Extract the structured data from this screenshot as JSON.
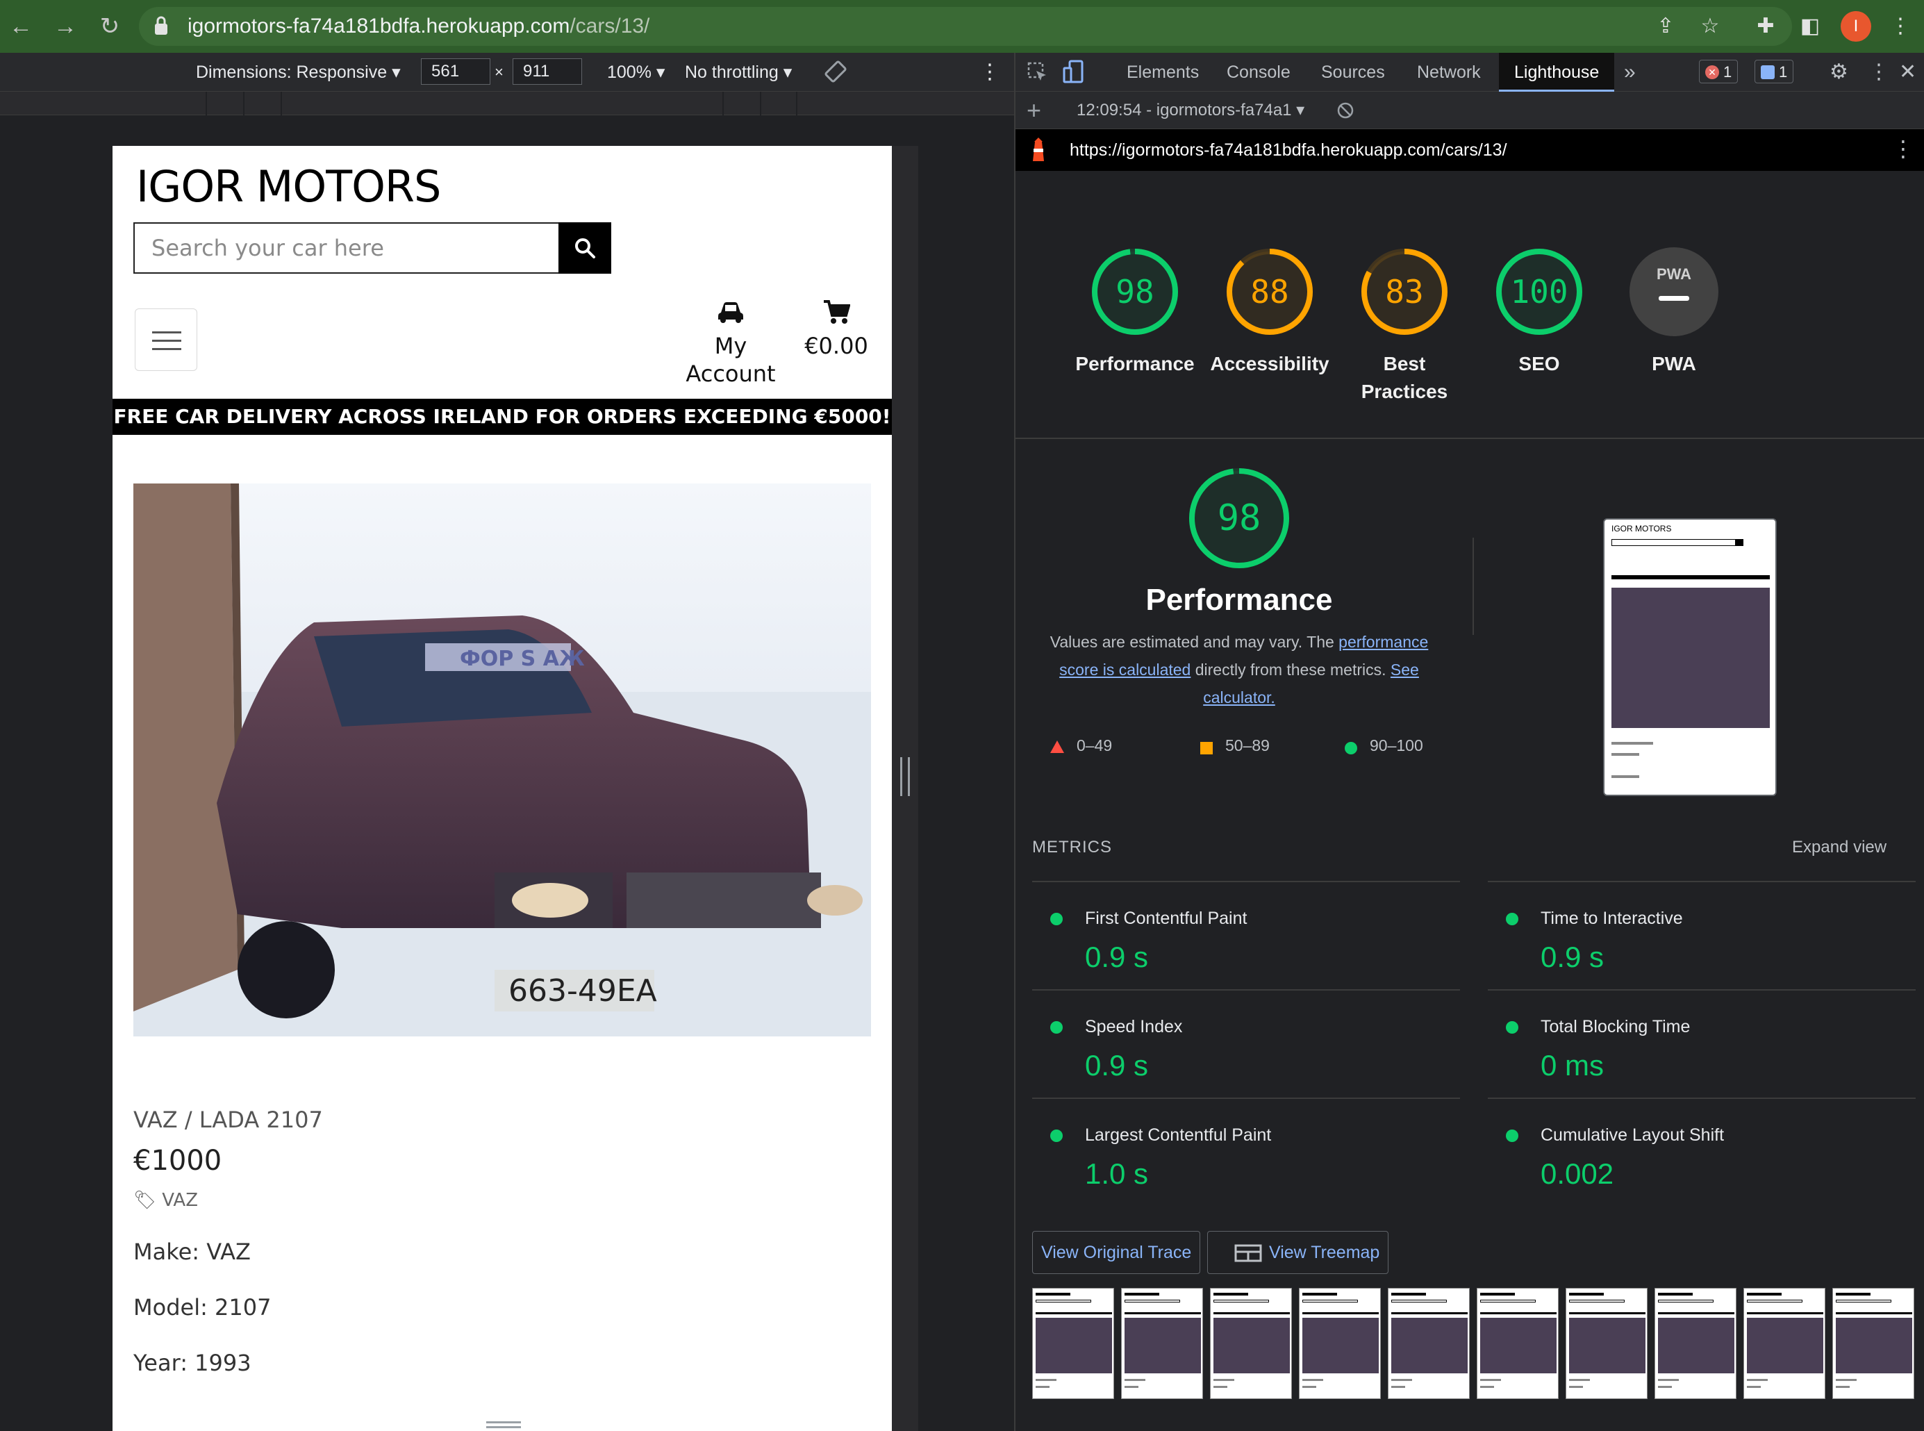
{
  "browser": {
    "url_host": "igormotors-fa74a181bdfa.herokuapp.com",
    "url_path": "/cars/13/",
    "profile_initial": "I"
  },
  "device_toolbar": {
    "dimensions_label": "Dimensions: Responsive",
    "width": "561",
    "height": "911",
    "times": "×",
    "zoom": "100%",
    "throttling": "No throttling"
  },
  "site": {
    "brand": "IGOR MOTORS",
    "search_placeholder": "Search your car here",
    "account_label": "My Account",
    "cart_total": "€0.00",
    "banner": "FREE CAR DELIVERY ACROSS IRELAND FOR ORDERS EXCEEDING €5000!",
    "plate_text": "663-49EA",
    "windshield_text": "ФОР S АЖ",
    "car": {
      "name": "VAZ / LADA 2107",
      "price": "€1000",
      "tag": "VAZ",
      "specs": [
        "Make: VAZ",
        "Model: 2107",
        "Year: 1993"
      ]
    }
  },
  "devtools": {
    "tabs": [
      "Elements",
      "Console",
      "Sources",
      "Network",
      "Lighthouse"
    ],
    "active_tab": "Lighthouse",
    "more": "»",
    "error_count": "1",
    "message_count": "1",
    "report_time": "12:09:54 - igormotors-fa74a1",
    "report_url": "https://igormotors-fa74a181bdfa.herokuapp.com/cars/13/",
    "colors": {
      "pass": "#0cce6b",
      "average": "#ffa400",
      "fail": "#ff4e42"
    },
    "scores": [
      {
        "label": "Performance",
        "value": "98",
        "score": 0.98,
        "status": "pass"
      },
      {
        "label": "Accessibility",
        "value": "88",
        "score": 0.88,
        "status": "average"
      },
      {
        "label": "Best Practices",
        "value": "83",
        "score": 0.83,
        "status": "average"
      },
      {
        "label": "SEO",
        "value": "100",
        "score": 1.0,
        "status": "pass"
      },
      {
        "label": "PWA",
        "value": "PWA",
        "status": "na"
      }
    ],
    "performance": {
      "score": "98",
      "title": "Performance",
      "desc_before": "Values are estimated and may vary. The ",
      "desc_link1": "performance score is calculated",
      "desc_middle": " directly from these metrics. ",
      "desc_link2": "See calculator.",
      "legend": [
        "0–49",
        "50–89",
        "90–100"
      ],
      "thumb_brand": "IGOR MOTORS"
    },
    "metrics_title": "METRICS",
    "expand_label": "Expand view",
    "metrics": [
      {
        "label": "First Contentful Paint",
        "value": "0.9 s"
      },
      {
        "label": "Time to Interactive",
        "value": "0.9 s"
      },
      {
        "label": "Speed Index",
        "value": "0.9 s"
      },
      {
        "label": "Total Blocking Time",
        "value": "0 ms"
      },
      {
        "label": "Largest Contentful Paint",
        "value": "1.0 s"
      },
      {
        "label": "Cumulative Layout Shift",
        "value": "0.002"
      }
    ],
    "view_trace_label": "View Original Trace",
    "view_treemap_label": "View Treemap"
  }
}
